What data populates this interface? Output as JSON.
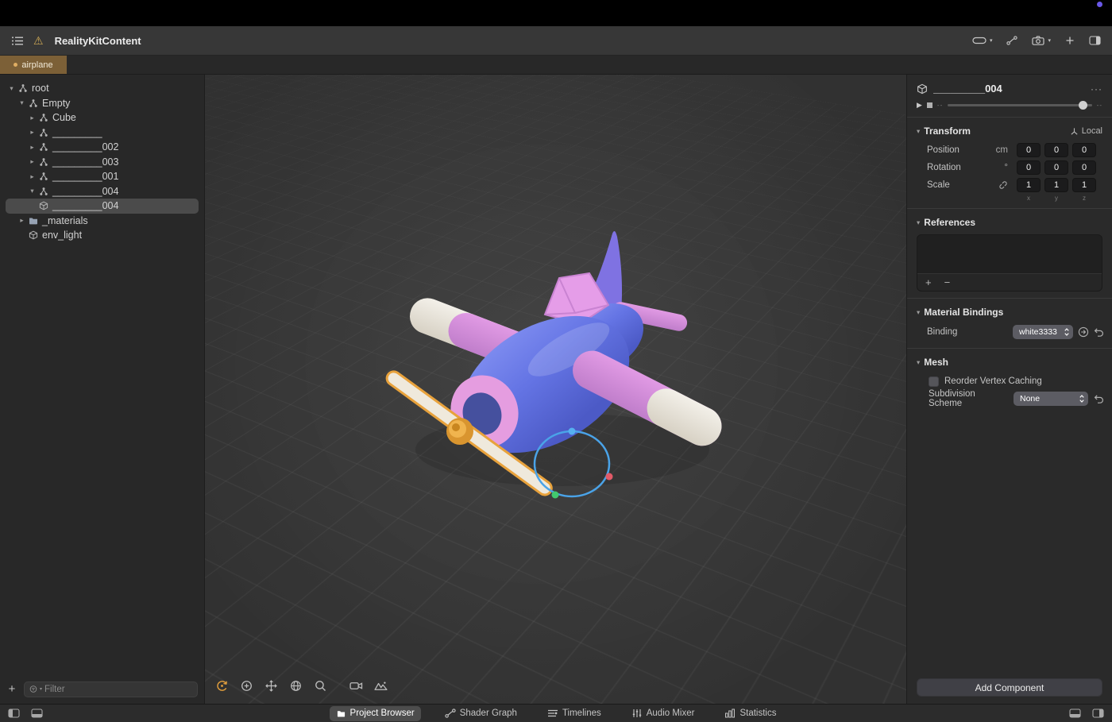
{
  "window": {
    "title": "RealityKitContent",
    "active_tab": "airplane"
  },
  "sidebar": {
    "items": [
      {
        "label": "root"
      },
      {
        "label": "Empty"
      },
      {
        "label": "Cube"
      },
      {
        "label": "_________"
      },
      {
        "label": "_________002"
      },
      {
        "label": "_________003"
      },
      {
        "label": "_________001"
      },
      {
        "label": "_________004"
      },
      {
        "label": "_________004"
      },
      {
        "label": "_materials"
      },
      {
        "label": "env_light"
      }
    ],
    "add_label": "+",
    "filter_placeholder": "Filter"
  },
  "inspector": {
    "title": "_________004",
    "playback": {
      "time_left": "--",
      "time_right": "--"
    },
    "transform": {
      "title": "Transform",
      "space_label": "Local",
      "position": {
        "label": "Position",
        "unit": "cm",
        "values": [
          "0",
          "0",
          "0"
        ]
      },
      "rotation": {
        "label": "Rotation",
        "unit": "°",
        "values": [
          "0",
          "0",
          "0"
        ]
      },
      "scale": {
        "label": "Scale",
        "values": [
          "1",
          "1",
          "1"
        ],
        "axes": [
          "x",
          "y",
          "z"
        ]
      }
    },
    "references": {
      "title": "References",
      "add": "+",
      "remove": "−"
    },
    "material_bindings": {
      "title": "Material Bindings",
      "binding_label": "Binding",
      "binding_value": "white3333"
    },
    "mesh": {
      "title": "Mesh",
      "reorder_label": "Reorder Vertex Caching",
      "subdivision_label": "Subdivision Scheme",
      "subdivision_value": "None"
    },
    "add_component_label": "Add Component"
  },
  "bottom_bar": {
    "tabs": [
      {
        "label": "Project Browser"
      },
      {
        "label": "Shader Graph"
      },
      {
        "label": "Timelines"
      },
      {
        "label": "Audio Mixer"
      },
      {
        "label": "Statistics"
      }
    ]
  },
  "colors": {
    "accent_orange": "#e8a23c",
    "selection_blue": "#4aa3e8",
    "active_tab_brown": "#7c6037",
    "recording_dot_purple": "#6a58e8"
  }
}
